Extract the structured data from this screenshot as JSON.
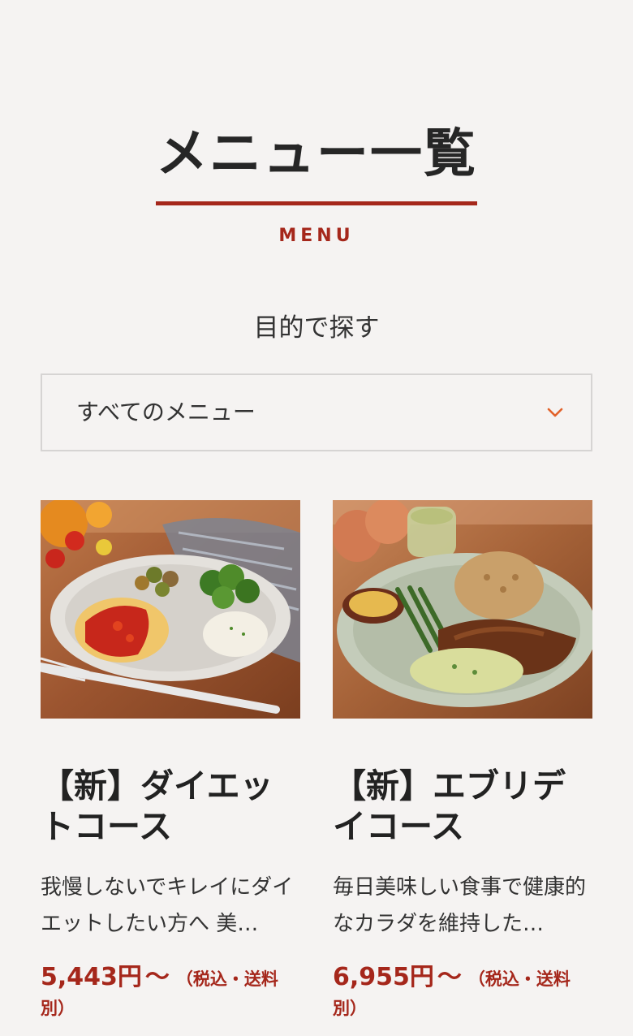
{
  "header": {
    "title": "メニュー一覧",
    "subtitle": "MENU"
  },
  "filter": {
    "label": "目的で探す",
    "selected": "すべてのメニュー",
    "icon": "chevron-down-icon"
  },
  "colors": {
    "accent": "#a5271b",
    "chevron": "#e2622a",
    "background": "#f5f3f2"
  },
  "menu_items": [
    {
      "title": "【新】ダイエットコース",
      "description": "我慢しないでキレイにダイエットしたい方へ 美…",
      "price": "5,443円",
      "price_suffix": "〜",
      "price_note": "（税込・送料別）"
    },
    {
      "title": "【新】エブリデイコース",
      "description": "毎日美味しい食事で健康的なカラダを維持した…",
      "price": "6,955円",
      "price_suffix": "〜",
      "price_note": "（税込・送料別）"
    }
  ]
}
